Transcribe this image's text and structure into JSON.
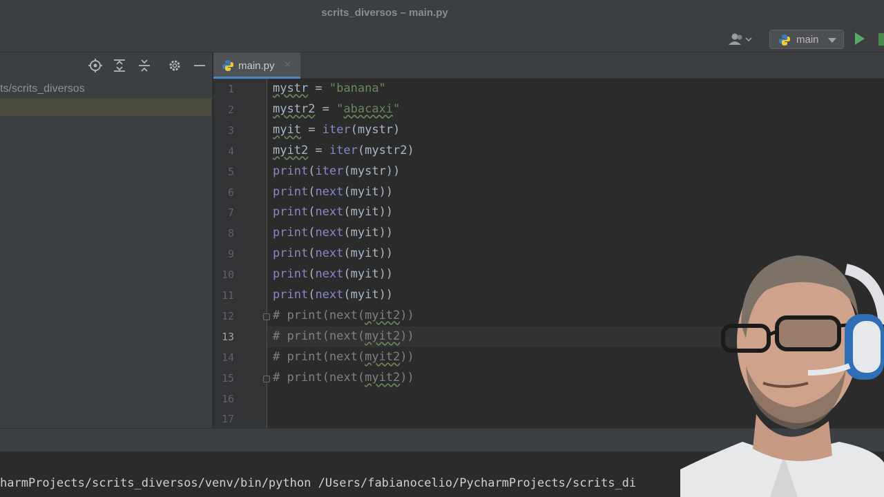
{
  "window": {
    "title": "scrits_diversos – main.py"
  },
  "toolbar": {
    "run_config_label": "main",
    "colors": {
      "run": "#59a869",
      "accent": "#4a88c7"
    }
  },
  "project_panel": {
    "root_label": "ts/scrits_diversos"
  },
  "editor": {
    "active_tab": "main.py",
    "current_line": 13,
    "line_numbers": [
      "1",
      "2",
      "3",
      "4",
      "5",
      "6",
      "7",
      "8",
      "9",
      "10",
      "11",
      "12",
      "13",
      "14",
      "15",
      "16",
      "17"
    ],
    "lines": [
      {
        "segments": [
          {
            "t": "mystr",
            "c": "typo"
          },
          {
            "t": " = ",
            "c": ""
          },
          {
            "t": "\"banana\"",
            "c": "str"
          }
        ]
      },
      {
        "segments": [
          {
            "t": "mystr2",
            "c": "typo"
          },
          {
            "t": " = ",
            "c": ""
          },
          {
            "t": "\"",
            "c": "str"
          },
          {
            "t": "abacaxi",
            "c": "str typo"
          },
          {
            "t": "\"",
            "c": "str"
          }
        ]
      },
      {
        "segments": [
          {
            "t": "myit",
            "c": "typo"
          },
          {
            "t": " = ",
            "c": ""
          },
          {
            "t": "iter",
            "c": "kw"
          },
          {
            "t": "(mystr)",
            "c": ""
          }
        ]
      },
      {
        "segments": [
          {
            "t": "myit2",
            "c": "typo"
          },
          {
            "t": " = ",
            "c": ""
          },
          {
            "t": "iter",
            "c": "kw"
          },
          {
            "t": "(mystr2)",
            "c": ""
          }
        ]
      },
      {
        "segments": [
          {
            "t": "print",
            "c": "kw"
          },
          {
            "t": "(",
            "c": ""
          },
          {
            "t": "iter",
            "c": "kw"
          },
          {
            "t": "(mystr))",
            "c": ""
          }
        ]
      },
      {
        "segments": [
          {
            "t": "print",
            "c": "kw"
          },
          {
            "t": "(",
            "c": ""
          },
          {
            "t": "next",
            "c": "kw"
          },
          {
            "t": "(myit))",
            "c": ""
          }
        ]
      },
      {
        "segments": [
          {
            "t": "print",
            "c": "kw"
          },
          {
            "t": "(",
            "c": ""
          },
          {
            "t": "next",
            "c": "kw"
          },
          {
            "t": "(myit))",
            "c": ""
          }
        ]
      },
      {
        "segments": [
          {
            "t": "print",
            "c": "kw"
          },
          {
            "t": "(",
            "c": ""
          },
          {
            "t": "next",
            "c": "kw"
          },
          {
            "t": "(myit))",
            "c": ""
          }
        ]
      },
      {
        "segments": [
          {
            "t": "print",
            "c": "kw"
          },
          {
            "t": "(",
            "c": ""
          },
          {
            "t": "next",
            "c": "kw"
          },
          {
            "t": "(myit))",
            "c": ""
          }
        ]
      },
      {
        "segments": [
          {
            "t": "print",
            "c": "kw"
          },
          {
            "t": "(",
            "c": ""
          },
          {
            "t": "next",
            "c": "kw"
          },
          {
            "t": "(myit))",
            "c": ""
          }
        ]
      },
      {
        "segments": [
          {
            "t": "print",
            "c": "kw"
          },
          {
            "t": "(",
            "c": ""
          },
          {
            "t": "next",
            "c": "kw"
          },
          {
            "t": "(myit))",
            "c": ""
          }
        ]
      },
      {
        "segments": [
          {
            "t": "# print(next(",
            "c": "cm"
          },
          {
            "t": "myit2",
            "c": "cm typo"
          },
          {
            "t": "))",
            "c": "cm"
          }
        ]
      },
      {
        "segments": [
          {
            "t": "# print(next(",
            "c": "cm"
          },
          {
            "t": "myit2",
            "c": "cm typo"
          },
          {
            "t": "))",
            "c": "cm"
          }
        ]
      },
      {
        "segments": [
          {
            "t": "# print(next(",
            "c": "cm"
          },
          {
            "t": "myit2",
            "c": "cm typo"
          },
          {
            "t": "))",
            "c": "cm"
          }
        ]
      },
      {
        "segments": [
          {
            "t": "# print(next(",
            "c": "cm"
          },
          {
            "t": "myit2",
            "c": "cm typo"
          },
          {
            "t": "))",
            "c": "cm"
          }
        ]
      },
      {
        "segments": []
      },
      {
        "segments": []
      }
    ]
  },
  "console": {
    "command": "harmProjects/scrits_diversos/venv/bin/python /Users/fabianocelio/PycharmProjects/scrits_di"
  }
}
